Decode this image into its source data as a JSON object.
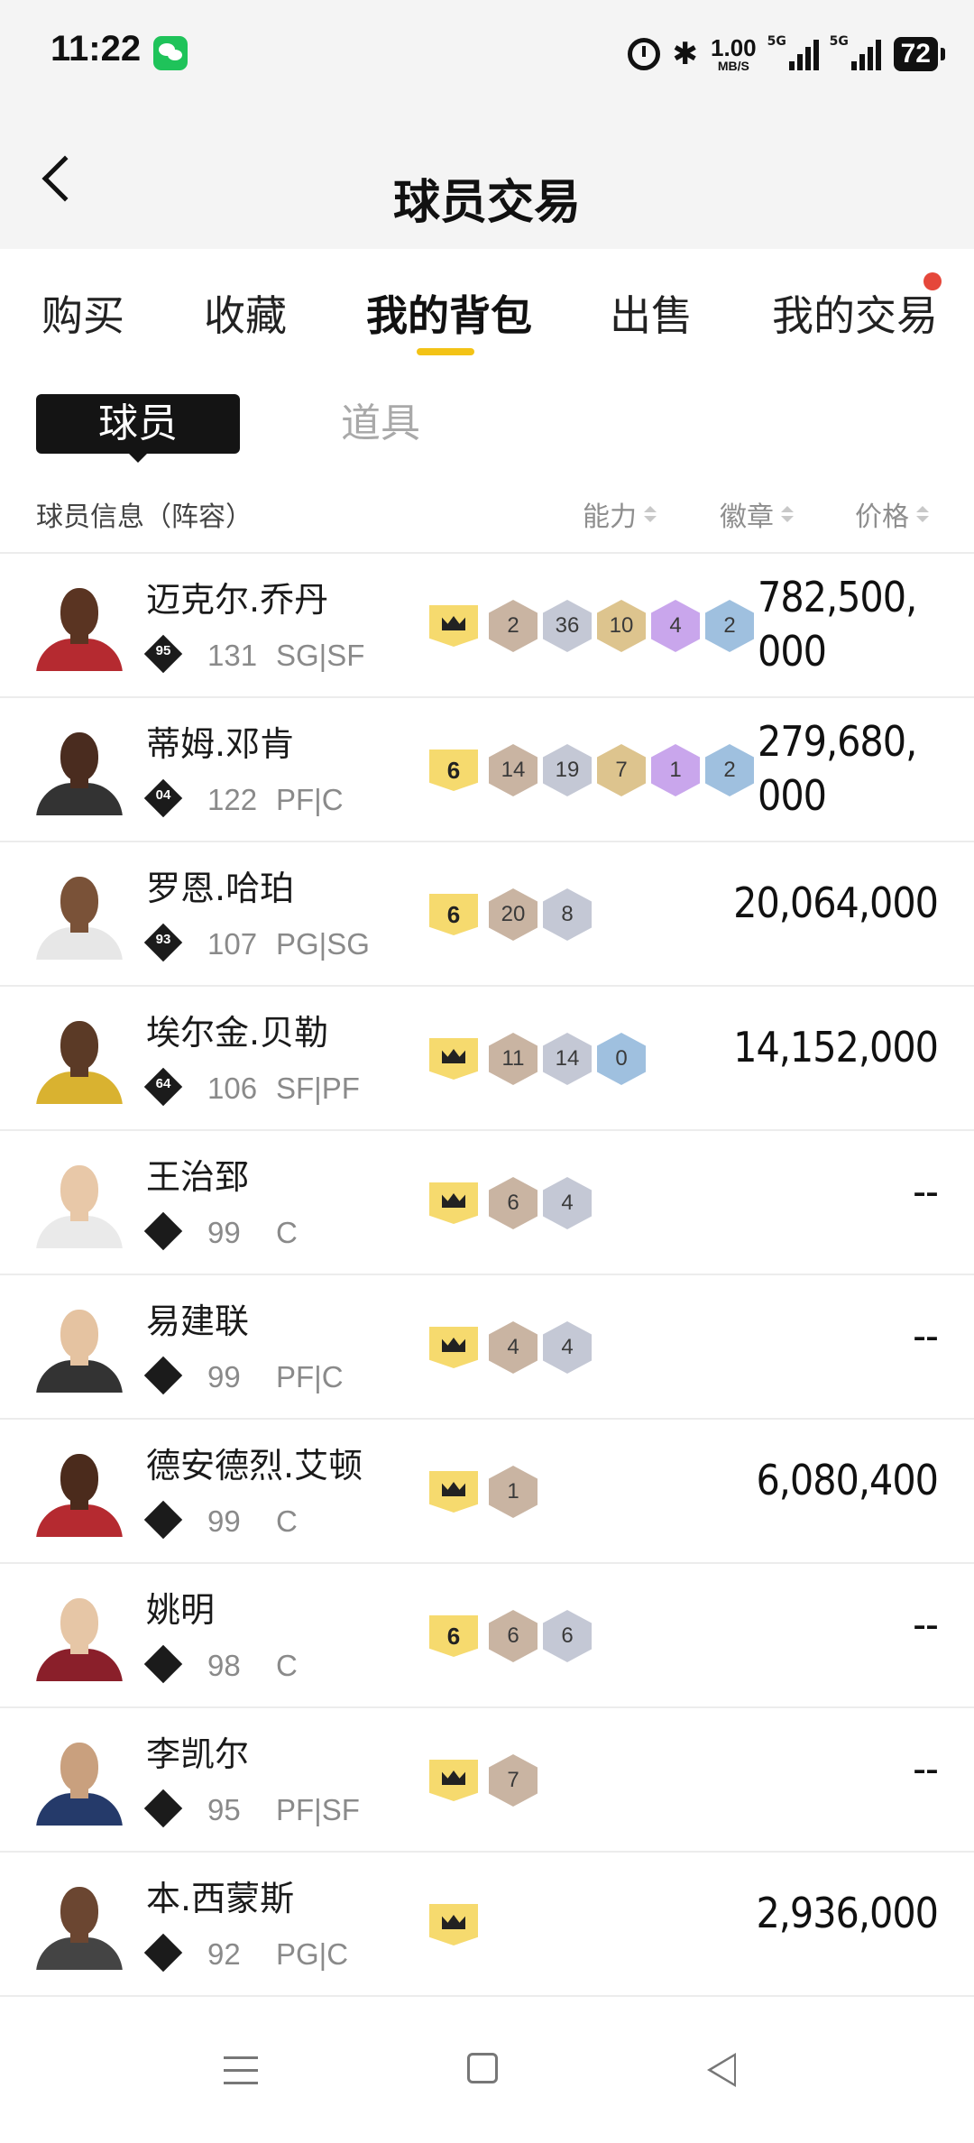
{
  "status_bar": {
    "time": "11:22",
    "net_speed": "1.00",
    "net_unit": "MB/S",
    "signal1_label": "5G",
    "signal2_label": "5G",
    "battery": "72"
  },
  "header": {
    "title": "球员交易"
  },
  "tabs": [
    {
      "label": "购买"
    },
    {
      "label": "收藏"
    },
    {
      "label": "我的背包"
    },
    {
      "label": "出售"
    },
    {
      "label": "我的交易"
    }
  ],
  "segments": {
    "active": "球员",
    "inactive": "道具"
  },
  "columns": {
    "info": "球员信息（阵容）",
    "ability": "能力",
    "badge": "徽章",
    "price": "价格"
  },
  "players": [
    {
      "name": "迈克尔.乔丹",
      "tier": "95",
      "rating": "131",
      "position": "SG|SF",
      "level": "crown",
      "badges": [
        {
          "type": "bronze",
          "n": "2"
        },
        {
          "type": "silver",
          "n": "36"
        },
        {
          "type": "gold",
          "n": "10"
        },
        {
          "type": "purple",
          "n": "4"
        },
        {
          "type": "blue",
          "n": "2"
        }
      ],
      "price": "782,500,000"
    },
    {
      "name": "蒂姆.邓肯",
      "tier": "04",
      "rating": "122",
      "position": "PF|C",
      "level": "6",
      "badges": [
        {
          "type": "bronze",
          "n": "14"
        },
        {
          "type": "silver",
          "n": "19"
        },
        {
          "type": "gold",
          "n": "7"
        },
        {
          "type": "purple",
          "n": "1"
        },
        {
          "type": "blue",
          "n": "2"
        }
      ],
      "price": "279,680,000"
    },
    {
      "name": "罗恩.哈珀",
      "tier": "93",
      "rating": "107",
      "position": "PG|SG",
      "level": "6",
      "badges": [
        {
          "type": "bronze",
          "n": "20"
        },
        {
          "type": "silver",
          "n": "8"
        }
      ],
      "price": "20,064,000"
    },
    {
      "name": "埃尔金.贝勒",
      "tier": "64",
      "rating": "106",
      "position": "SF|PF",
      "level": "crown",
      "badges": [
        {
          "type": "bronze",
          "n": "11"
        },
        {
          "type": "silver",
          "n": "14"
        },
        {
          "type": "blue",
          "n": "0"
        }
      ],
      "price": "14,152,000"
    },
    {
      "name": "王治郅",
      "tier": "",
      "rating": "99",
      "position": "C",
      "level": "crown",
      "badges": [
        {
          "type": "bronze",
          "n": "6"
        },
        {
          "type": "silver",
          "n": "4"
        }
      ],
      "price": "--"
    },
    {
      "name": "易建联",
      "tier": "",
      "rating": "99",
      "position": "PF|C",
      "level": "crown",
      "badges": [
        {
          "type": "bronze",
          "n": "4"
        },
        {
          "type": "silver",
          "n": "4"
        }
      ],
      "price": "--"
    },
    {
      "name": "德安德烈.艾顿",
      "tier": "",
      "rating": "99",
      "position": "C",
      "level": "crown",
      "badges": [
        {
          "type": "bronze",
          "n": "1"
        }
      ],
      "price": "6,080,400"
    },
    {
      "name": "姚明",
      "tier": "",
      "rating": "98",
      "position": "C",
      "level": "6",
      "badges": [
        {
          "type": "bronze",
          "n": "6"
        },
        {
          "type": "silver",
          "n": "6"
        }
      ],
      "price": "--"
    },
    {
      "name": "李凯尔",
      "tier": "",
      "rating": "95",
      "position": "PF|SF",
      "level": "crown",
      "badges": [
        {
          "type": "bronze",
          "n": "7"
        }
      ],
      "price": "--"
    },
    {
      "name": "本.西蒙斯",
      "tier": "",
      "rating": "92",
      "position": "PG|C",
      "level": "crown",
      "badges": [],
      "price": "2,936,000"
    }
  ],
  "colors": {
    "accent": "#f3c316",
    "notify_dot": "#e5473a",
    "level_badge": "#f6da6e"
  }
}
